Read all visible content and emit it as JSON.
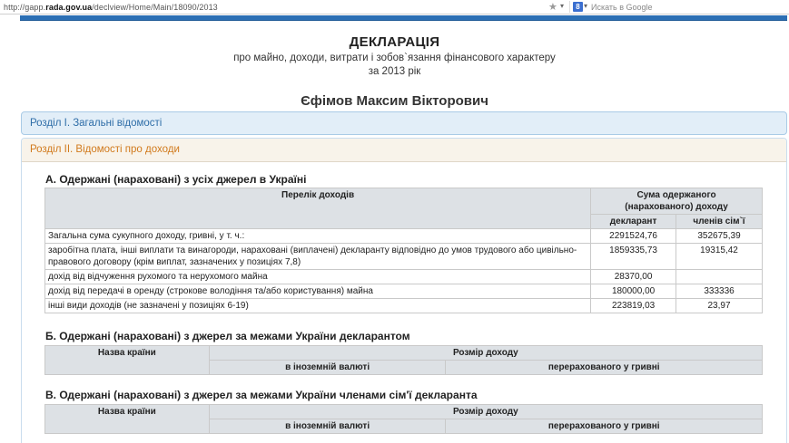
{
  "browser": {
    "url_prefix": "http://gapp.",
    "url_domain": "rada.gov.ua",
    "url_path": "/declview/Home/Main/18090/2013",
    "search_placeholder": "Искать в Google",
    "search_engine_glyph": "8"
  },
  "header": {
    "title": "ДЕКЛАРАЦІЯ",
    "subtitle_line1": "про майно, доходи, витрати і зобов`язання фінансового характеру",
    "subtitle_line2": "за 2013 рік",
    "person_name": "Єфімов Максим Вікторович"
  },
  "sections": {
    "section1_title": "Розділ I. Загальні відомості",
    "section2_title": "Розділ II. Відомості про доходи"
  },
  "part_a": {
    "title": "А. Одержані (нараховані) з усіх джерел в Україні",
    "col_list": "Перелік доходів",
    "col_sum": "Сума одержаного (нарахованого) доходу",
    "col_declarant": "декларант",
    "col_family": "членів сім`ї",
    "rows": [
      {
        "label": "Загальна сума сукупного доходу, гривні, у т. ч.:",
        "declarant": "2291524,76",
        "family": "352675,39"
      },
      {
        "label": "заробітна плата, інші виплати та винагороди, нараховані (виплачені) декларанту відповідно до умов трудового або цивільно-правового договору (крім виплат, зазначених у позиціях 7,8)",
        "declarant": "1859335,73",
        "family": "19315,42"
      },
      {
        "label": "дохід від відчуження рухомого та нерухомого майна",
        "declarant": "28370,00",
        "family": ""
      },
      {
        "label": "дохід від передачі в оренду (строкове володіння та/або користування) майна",
        "declarant": "180000,00",
        "family": "333336"
      },
      {
        "label": "інші види доходів (не зазначені у позиціях 6-19)",
        "declarant": "223819,03",
        "family": "23,97"
      }
    ]
  },
  "part_b": {
    "title": "Б. Одержані (нараховані) з джерел за межами України декларантом",
    "col_country": "Назва країни",
    "col_size": "Розмір доходу",
    "col_foreign": "в іноземній валюті",
    "col_uah": "перерахованого у гривні"
  },
  "part_c": {
    "title": "В. Одержані (нараховані) з джерел за межами України членами сім'ї декларанта",
    "col_country": "Назва країни",
    "col_size": "Розмір доходу",
    "col_foreign": "в іноземній валюті",
    "col_uah": "перерахованого у гривні"
  }
}
